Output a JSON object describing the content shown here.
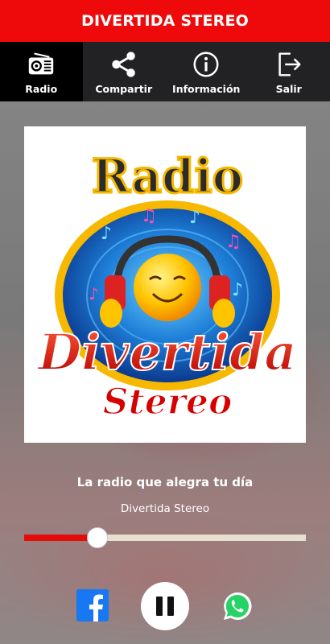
{
  "app": {
    "title": "DIVERTIDA STEREO"
  },
  "nav": {
    "items": [
      {
        "label": "Radio",
        "icon": "radio-icon",
        "active": true
      },
      {
        "label": "Compartir",
        "icon": "share-icon"
      },
      {
        "label": "Información",
        "icon": "info-icon"
      },
      {
        "label": "Salir",
        "icon": "exit-icon"
      }
    ]
  },
  "cover": {
    "logo_text_top": "Radio",
    "logo_text_mid": "Divertida",
    "logo_text_bottom": "Stereo"
  },
  "player": {
    "slogan": "La radio que alegra tu día",
    "station": "Divertida Stereo",
    "progress": 0.26,
    "state": "playing"
  },
  "social": {
    "facebook": "facebook-icon",
    "whatsapp": "whatsapp-icon"
  },
  "colors": {
    "accent": "#ee0a0a",
    "nav_bg": "#222224",
    "nav_active": "#000000",
    "facebook": "#1877f2",
    "whatsapp": "#25d366"
  }
}
